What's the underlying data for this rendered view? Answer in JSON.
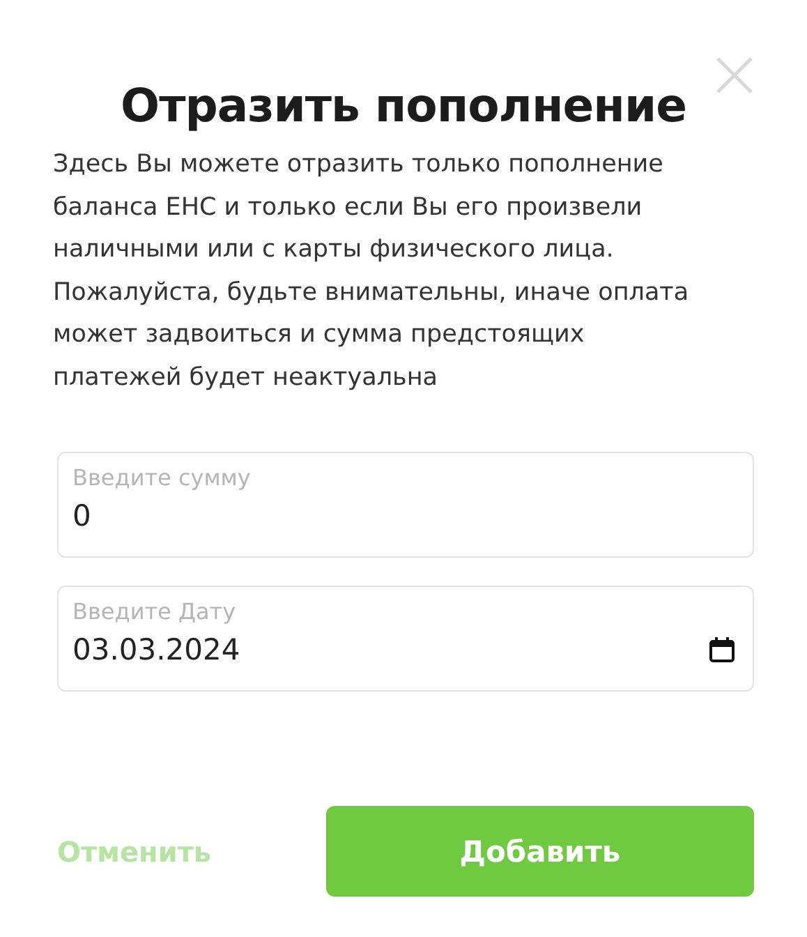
{
  "dialog": {
    "title": "Отразить пополнение",
    "description": "Здесь Вы можете отразить только пополнение баланса ЕНС и только если Вы его произвели наличными или с карты физического лица. Пожалуйста, будьте внимательны, иначе оплата может задвоиться и сумма предстоящих платежей будет неактуальна"
  },
  "fields": [
    {
      "kind": "amount",
      "label": "Введите сумму",
      "value": "0"
    },
    {
      "kind": "date",
      "label": "Введите Дату",
      "value": "03.03.2024"
    }
  ],
  "buttons": [
    {
      "kind": "cancel",
      "label": "Отменить"
    },
    {
      "kind": "primary",
      "label": "Добавить"
    }
  ]
}
